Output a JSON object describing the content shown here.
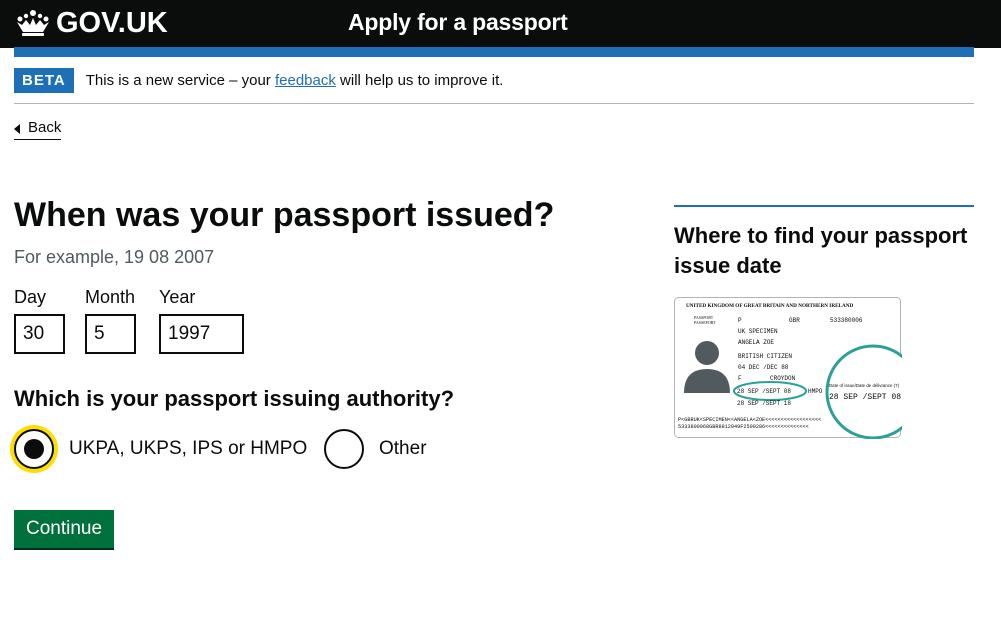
{
  "header": {
    "brand": "GOV.UK",
    "service_name": "Apply for a passport",
    "brand_color": "#0b0c0c",
    "accent_color": "#1d70b8"
  },
  "phase_banner": {
    "tag": "BETA",
    "text_before": "This is a new service – your ",
    "link": "feedback",
    "text_after": " will help us to improve it."
  },
  "back_link": "Back",
  "question": {
    "heading": "When was your passport issued?",
    "hint": "For example, 19 08 2007",
    "day": {
      "label": "Day",
      "value": "30"
    },
    "month": {
      "label": "Month",
      "value": "5"
    },
    "year": {
      "label": "Year",
      "value": "1997"
    }
  },
  "authority": {
    "heading": "Which is your passport issuing authority?",
    "options": [
      {
        "label": "UKPA, UKPS, IPS or HMPO",
        "selected": true
      },
      {
        "label": "Other",
        "selected": false
      }
    ]
  },
  "continue_label": "Continue",
  "continue_color": "#00703c",
  "aside": {
    "title": "Where to find your passport issue date",
    "passport_image": {
      "header": "UNITED KINGDOM OF GREAT BRITAIN AND NORTHERN IRELAND",
      "doc_label_1": "PASSPORT",
      "doc_label_2": "PASSEPORT",
      "type": "P",
      "code": "GBR",
      "number": "533380006",
      "surname": "UK SPECIMEN",
      "given_names": "ANGELA ZOE",
      "nationality": "BRITISH CITIZEN",
      "dob": "04 DEC /DEC 88",
      "sex": "F",
      "place_of_birth": "CROYDON",
      "issue_date": "28 SEP /SEPT 08",
      "expiry_date": "28 SEP /SEPT 18",
      "authority": "HMPO",
      "magnified_label": "Date of issue/Date de délivrance (7)",
      "magnified_value": "28 SEP /SEPT 08",
      "mrz_1": "P<GBRUK<SPECIMEN<<ANGELA<ZOE<<<<<<<<<<<<<<<<<<",
      "mrz_2": "5333800068GBR8812049F2509286<<<<<<<<<<<<<<",
      "highlight_color": "#28a197"
    }
  }
}
